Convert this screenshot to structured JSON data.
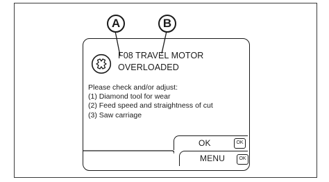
{
  "callouts": {
    "a": "A",
    "b": "B"
  },
  "error": {
    "icon": "circle-x-icon",
    "title_line1": "F08 TRAVEL MOTOR",
    "title_line2": "OVERLOADED"
  },
  "message": {
    "intro": "Please check and/or adjust:",
    "items": [
      "(1) Diamond tool for wear",
      "(2) Feed speed and straightness of cut",
      "(3) Saw carriage"
    ]
  },
  "buttons": {
    "ok_label": "OK",
    "ok_key": "OK",
    "menu_label": "MENU",
    "menu_key": "OK"
  }
}
